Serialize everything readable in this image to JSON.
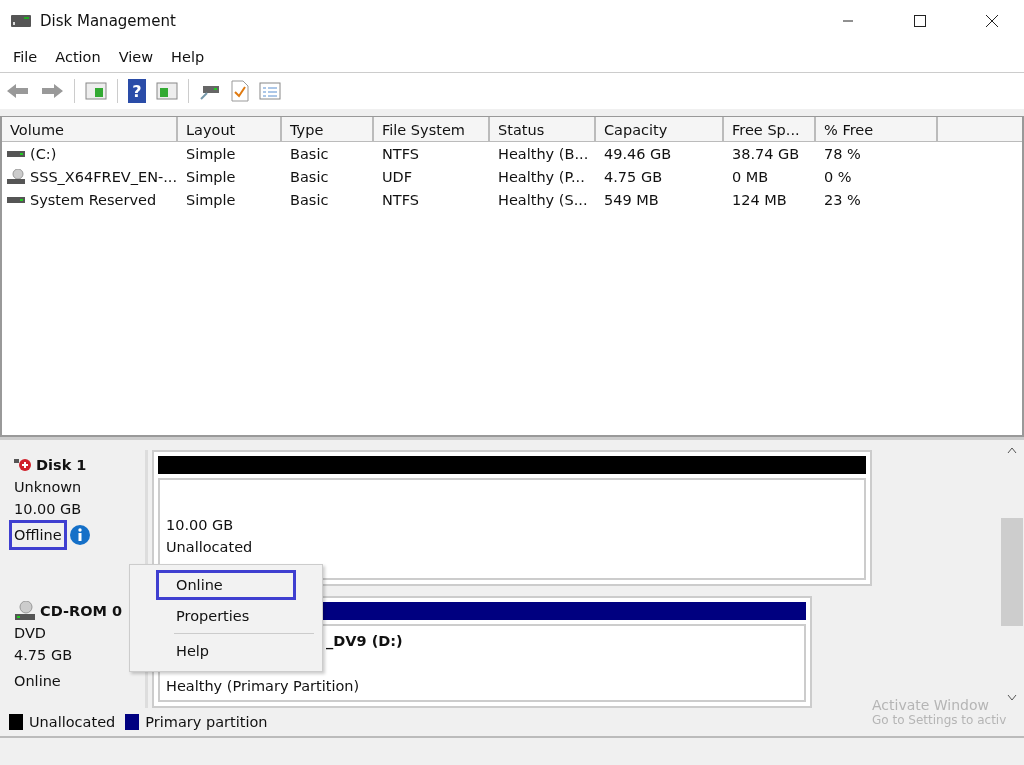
{
  "window": {
    "title": "Disk Management"
  },
  "menu": [
    "File",
    "Action",
    "View",
    "Help"
  ],
  "toolbar": {
    "help_glyph": "?"
  },
  "table": {
    "columns": [
      "Volume",
      "Layout",
      "Type",
      "File System",
      "Status",
      "Capacity",
      "Free Sp...",
      "% Free"
    ],
    "rows": [
      {
        "kind": "disk",
        "cells": [
          "(C:)",
          "Simple",
          "Basic",
          "NTFS",
          "Healthy (B...",
          "49.46 GB",
          "38.74 GB",
          "78 %"
        ]
      },
      {
        "kind": "cdrom",
        "cells": [
          "SSS_X64FREV_EN-...",
          "Simple",
          "Basic",
          "UDF",
          "Healthy (P...",
          "4.75 GB",
          "0 MB",
          "0 %"
        ]
      },
      {
        "kind": "disk",
        "cells": [
          "System Reserved",
          "Simple",
          "Basic",
          "NTFS",
          "Healthy (S...",
          "549 MB",
          "124 MB",
          "23 %"
        ]
      }
    ]
  },
  "disks": [
    {
      "kind": "offline",
      "name": "Disk 1",
      "type": "Unknown",
      "size": "10.00 GB",
      "status": "Offline",
      "annotated": true,
      "info": true,
      "partition": {
        "color": "#000000",
        "lines": [
          "10.00 GB",
          "Unallocated"
        ]
      }
    },
    {
      "kind": "cdrom",
      "name": "CD-ROM 0",
      "type": "DVD",
      "size": "4.75 GB",
      "status": "Online",
      "annotated": false,
      "info": false,
      "partition": {
        "color": "#000080",
        "lines": [
          "_DV9  (D:)",
          "Healthy (Primary Partition)"
        ]
      }
    }
  ],
  "context_menu": [
    {
      "label": "Online",
      "annotated": true
    },
    {
      "label": "Properties",
      "annotated": false
    },
    {
      "label": "Help",
      "annotated": false
    }
  ],
  "legend": [
    {
      "label": "Unallocated",
      "color": "#000000"
    },
    {
      "label": "Primary partition",
      "color": "#000080"
    }
  ],
  "activation": [
    "Activate Window",
    "Go to Settings to activ"
  ]
}
